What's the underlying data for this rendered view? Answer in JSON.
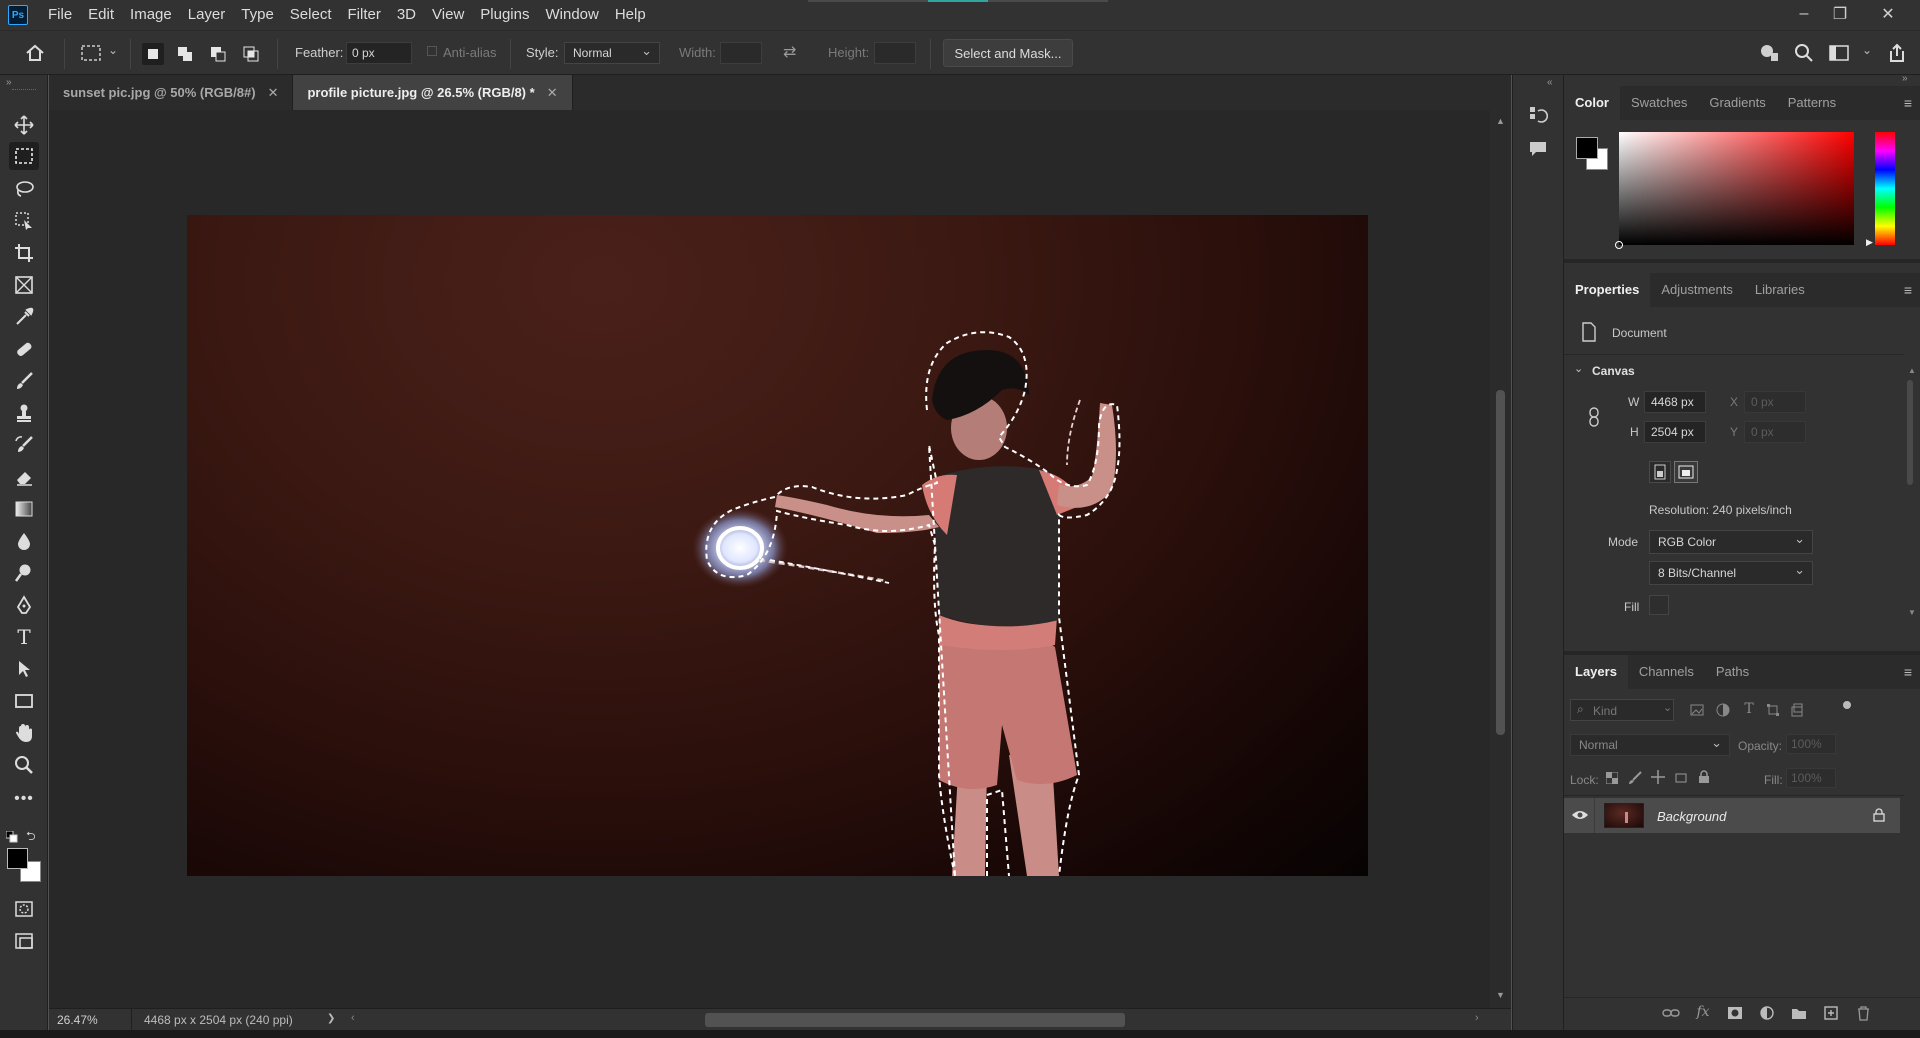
{
  "app": {
    "logo": "Ps"
  },
  "menu": [
    "File",
    "Edit",
    "Image",
    "Layer",
    "Type",
    "Select",
    "Filter",
    "3D",
    "View",
    "Plugins",
    "Window",
    "Help"
  ],
  "options": {
    "feather_label": "Feather:",
    "feather_value": "0 px",
    "antialias_label": "Anti-alias",
    "style_label": "Style:",
    "style_value": "Normal",
    "width_label": "Width:",
    "height_label": "Height:",
    "select_mask": "Select and Mask..."
  },
  "tabs": [
    {
      "label": "sunset pic.jpg @ 50% (RGB/8#)",
      "close": "✕"
    },
    {
      "label": "profile picture.jpg @ 26.5% (RGB/8) *",
      "close": "✕"
    }
  ],
  "status": {
    "zoom": "26.47%",
    "doc_info": "4468 px x 2504 px (240 ppi)",
    "arrow": "❯"
  },
  "color_panel": {
    "tabs": [
      "Color",
      "Swatches",
      "Gradients",
      "Patterns"
    ]
  },
  "properties_panel": {
    "tabs": [
      "Properties",
      "Adjustments",
      "Libraries"
    ],
    "doc_label": "Document",
    "section": "Canvas",
    "w_label": "W",
    "w_value": "4468 px",
    "h_label": "H",
    "h_value": "2504 px",
    "x_label": "X",
    "x_value": "0 px",
    "y_label": "Y",
    "y_value": "0 px",
    "resolution": "Resolution: 240 pixels/inch",
    "mode_label": "Mode",
    "mode_value": "RGB Color",
    "bits_value": "8 Bits/Channel",
    "fill_label": "Fill"
  },
  "layers_panel": {
    "tabs": [
      "Layers",
      "Channels",
      "Paths"
    ],
    "kind_placeholder": "Kind",
    "blend_mode": "Normal",
    "opacity_label": "Opacity:",
    "opacity_value": "100%",
    "lock_label": "Lock:",
    "fill_label": "Fill:",
    "fill_value": "100%",
    "layers": [
      {
        "name": "Background",
        "visible": true,
        "locked": true
      }
    ]
  },
  "colors": {
    "foreground": "#000000",
    "background": "#ffffff",
    "hue_ref": "#ff0000"
  }
}
